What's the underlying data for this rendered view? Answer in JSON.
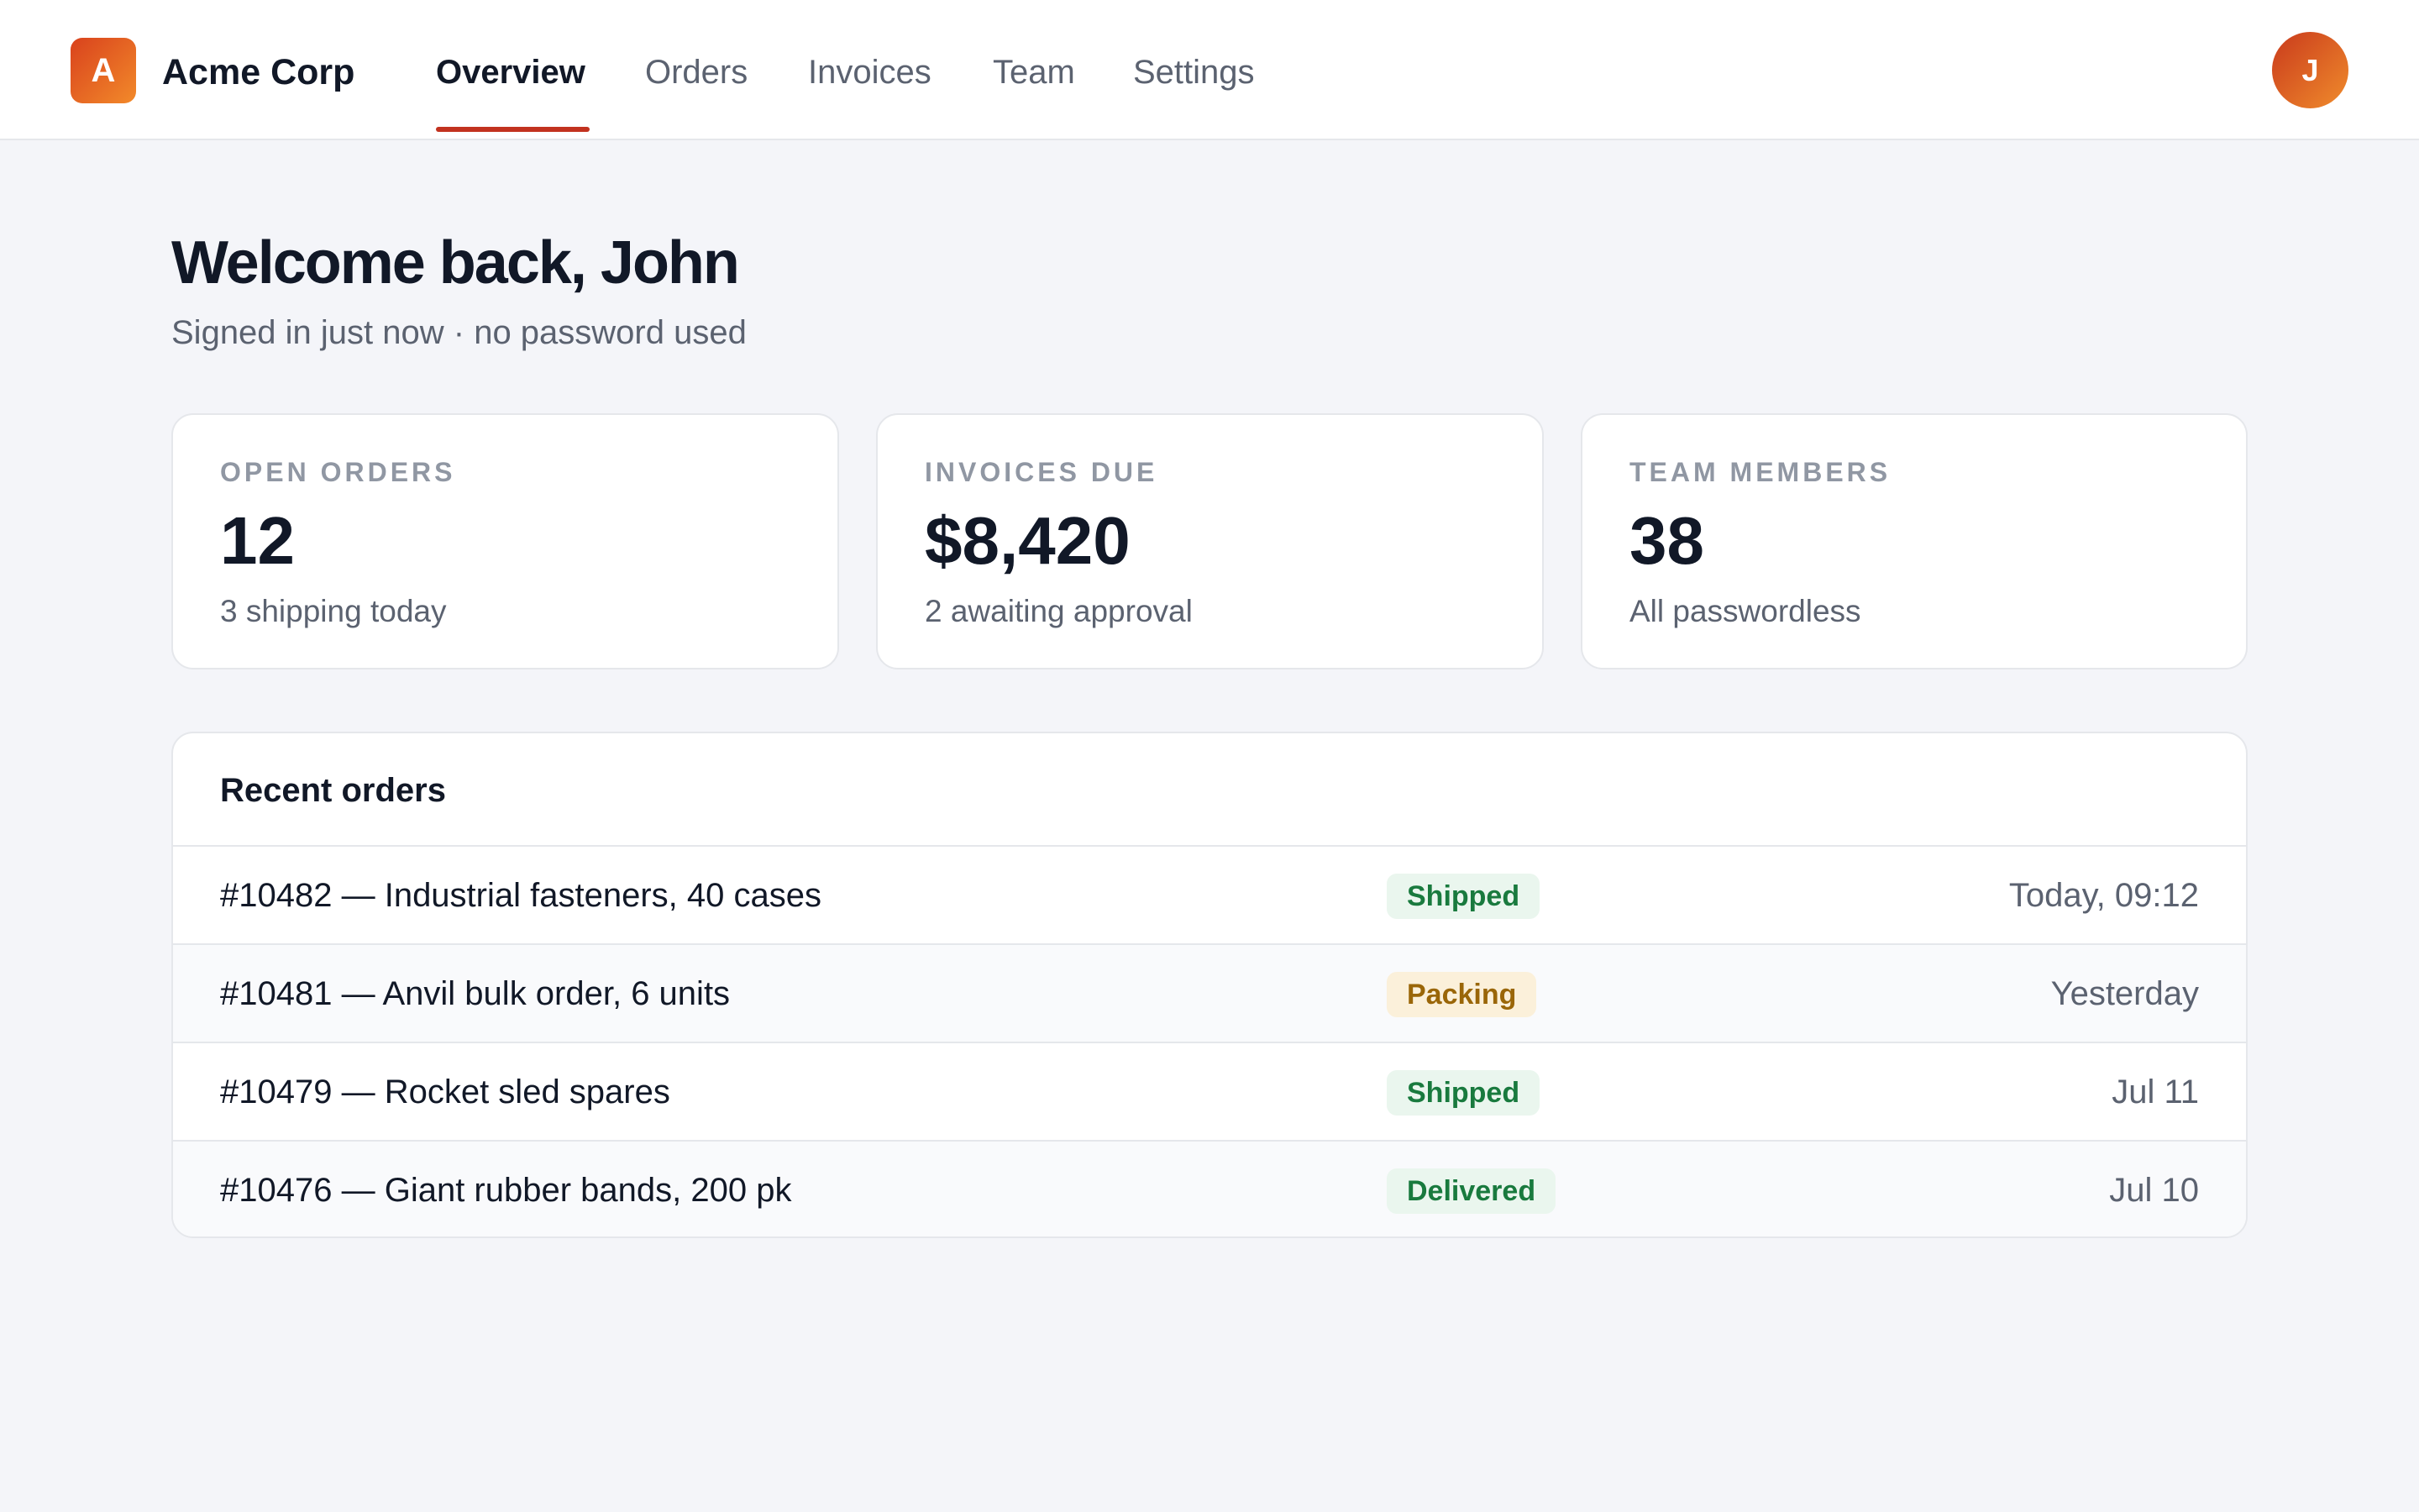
{
  "app": {
    "logo_letter": "A",
    "brand_name": "Acme Corp",
    "user_initial": "J"
  },
  "nav": {
    "tabs": [
      {
        "label": "Overview",
        "active": true
      },
      {
        "label": "Orders",
        "active": false
      },
      {
        "label": "Invoices",
        "active": false
      },
      {
        "label": "Team",
        "active": false
      },
      {
        "label": "Settings",
        "active": false
      }
    ]
  },
  "welcome": {
    "title": "Welcome back, John",
    "subtitle": "Signed in just now · no password used"
  },
  "stats": [
    {
      "label": "OPEN ORDERS",
      "value": "12",
      "note": "3 shipping today"
    },
    {
      "label": "INVOICES DUE",
      "value": "$8,420",
      "note": "2 awaiting approval"
    },
    {
      "label": "TEAM MEMBERS",
      "value": "38",
      "note": "All passwordless"
    }
  ],
  "recent_orders": {
    "title": "Recent orders",
    "rows": [
      {
        "description": "#10482 — Industrial fasteners, 40 cases",
        "status": "Shipped",
        "date": "Today, 09:12"
      },
      {
        "description": "#10481 — Anvil bulk order, 6 units",
        "status": "Packing",
        "date": "Yesterday"
      },
      {
        "description": "#10479 — Rocket sled spares",
        "status": "Shipped",
        "date": "Jul 11"
      },
      {
        "description": "#10476 — Giant rubber bands, 200 pk",
        "status": "Delivered",
        "date": "Jul 10"
      }
    ]
  },
  "colors": {
    "accent": "#c2321f",
    "status_shipped": "#197a3e",
    "status_packing": "#9a6608",
    "background": "#f4f5f9"
  }
}
